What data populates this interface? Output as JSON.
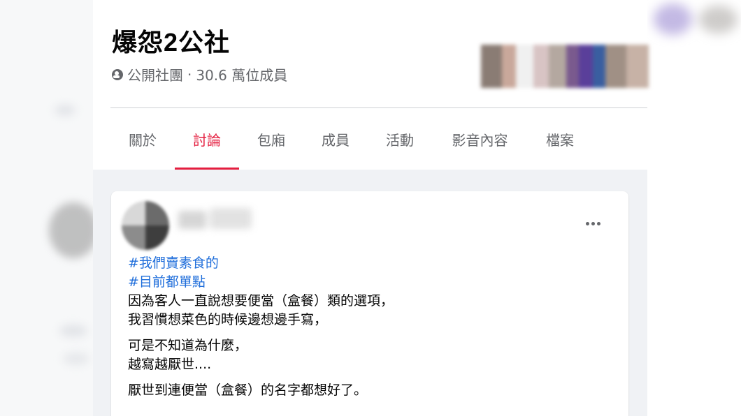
{
  "group": {
    "name": "爆怨2公社",
    "privacy": "公開社團",
    "separator": " · ",
    "members": "30.6 萬位成員"
  },
  "tabs": [
    {
      "label": "關於",
      "active": false
    },
    {
      "label": "討論",
      "active": true
    },
    {
      "label": "包廂",
      "active": false
    },
    {
      "label": "成員",
      "active": false
    },
    {
      "label": "活動",
      "active": false
    },
    {
      "label": "影音內容",
      "active": false
    },
    {
      "label": "檔案",
      "active": false
    }
  ],
  "post": {
    "hashtags": [
      "#我們賣素食的",
      "#目前都單點"
    ],
    "lines": [
      "因為客人一直說想要便當（盒餐）類的選項，",
      "我習慣想菜色的時候邊想邊手寫，",
      "可是不知道為什麼，",
      "越寫越厭世....",
      "厭世到連便當（盒餐）的名字都想好了。"
    ]
  },
  "colors": {
    "accent": "#e41e3f",
    "link": "#216fdb",
    "secondary_text": "#65676b",
    "feed_background": "#f0f2f5"
  },
  "icons": {
    "privacy": "globe-icon",
    "menu": "more-horizontal-icon"
  }
}
